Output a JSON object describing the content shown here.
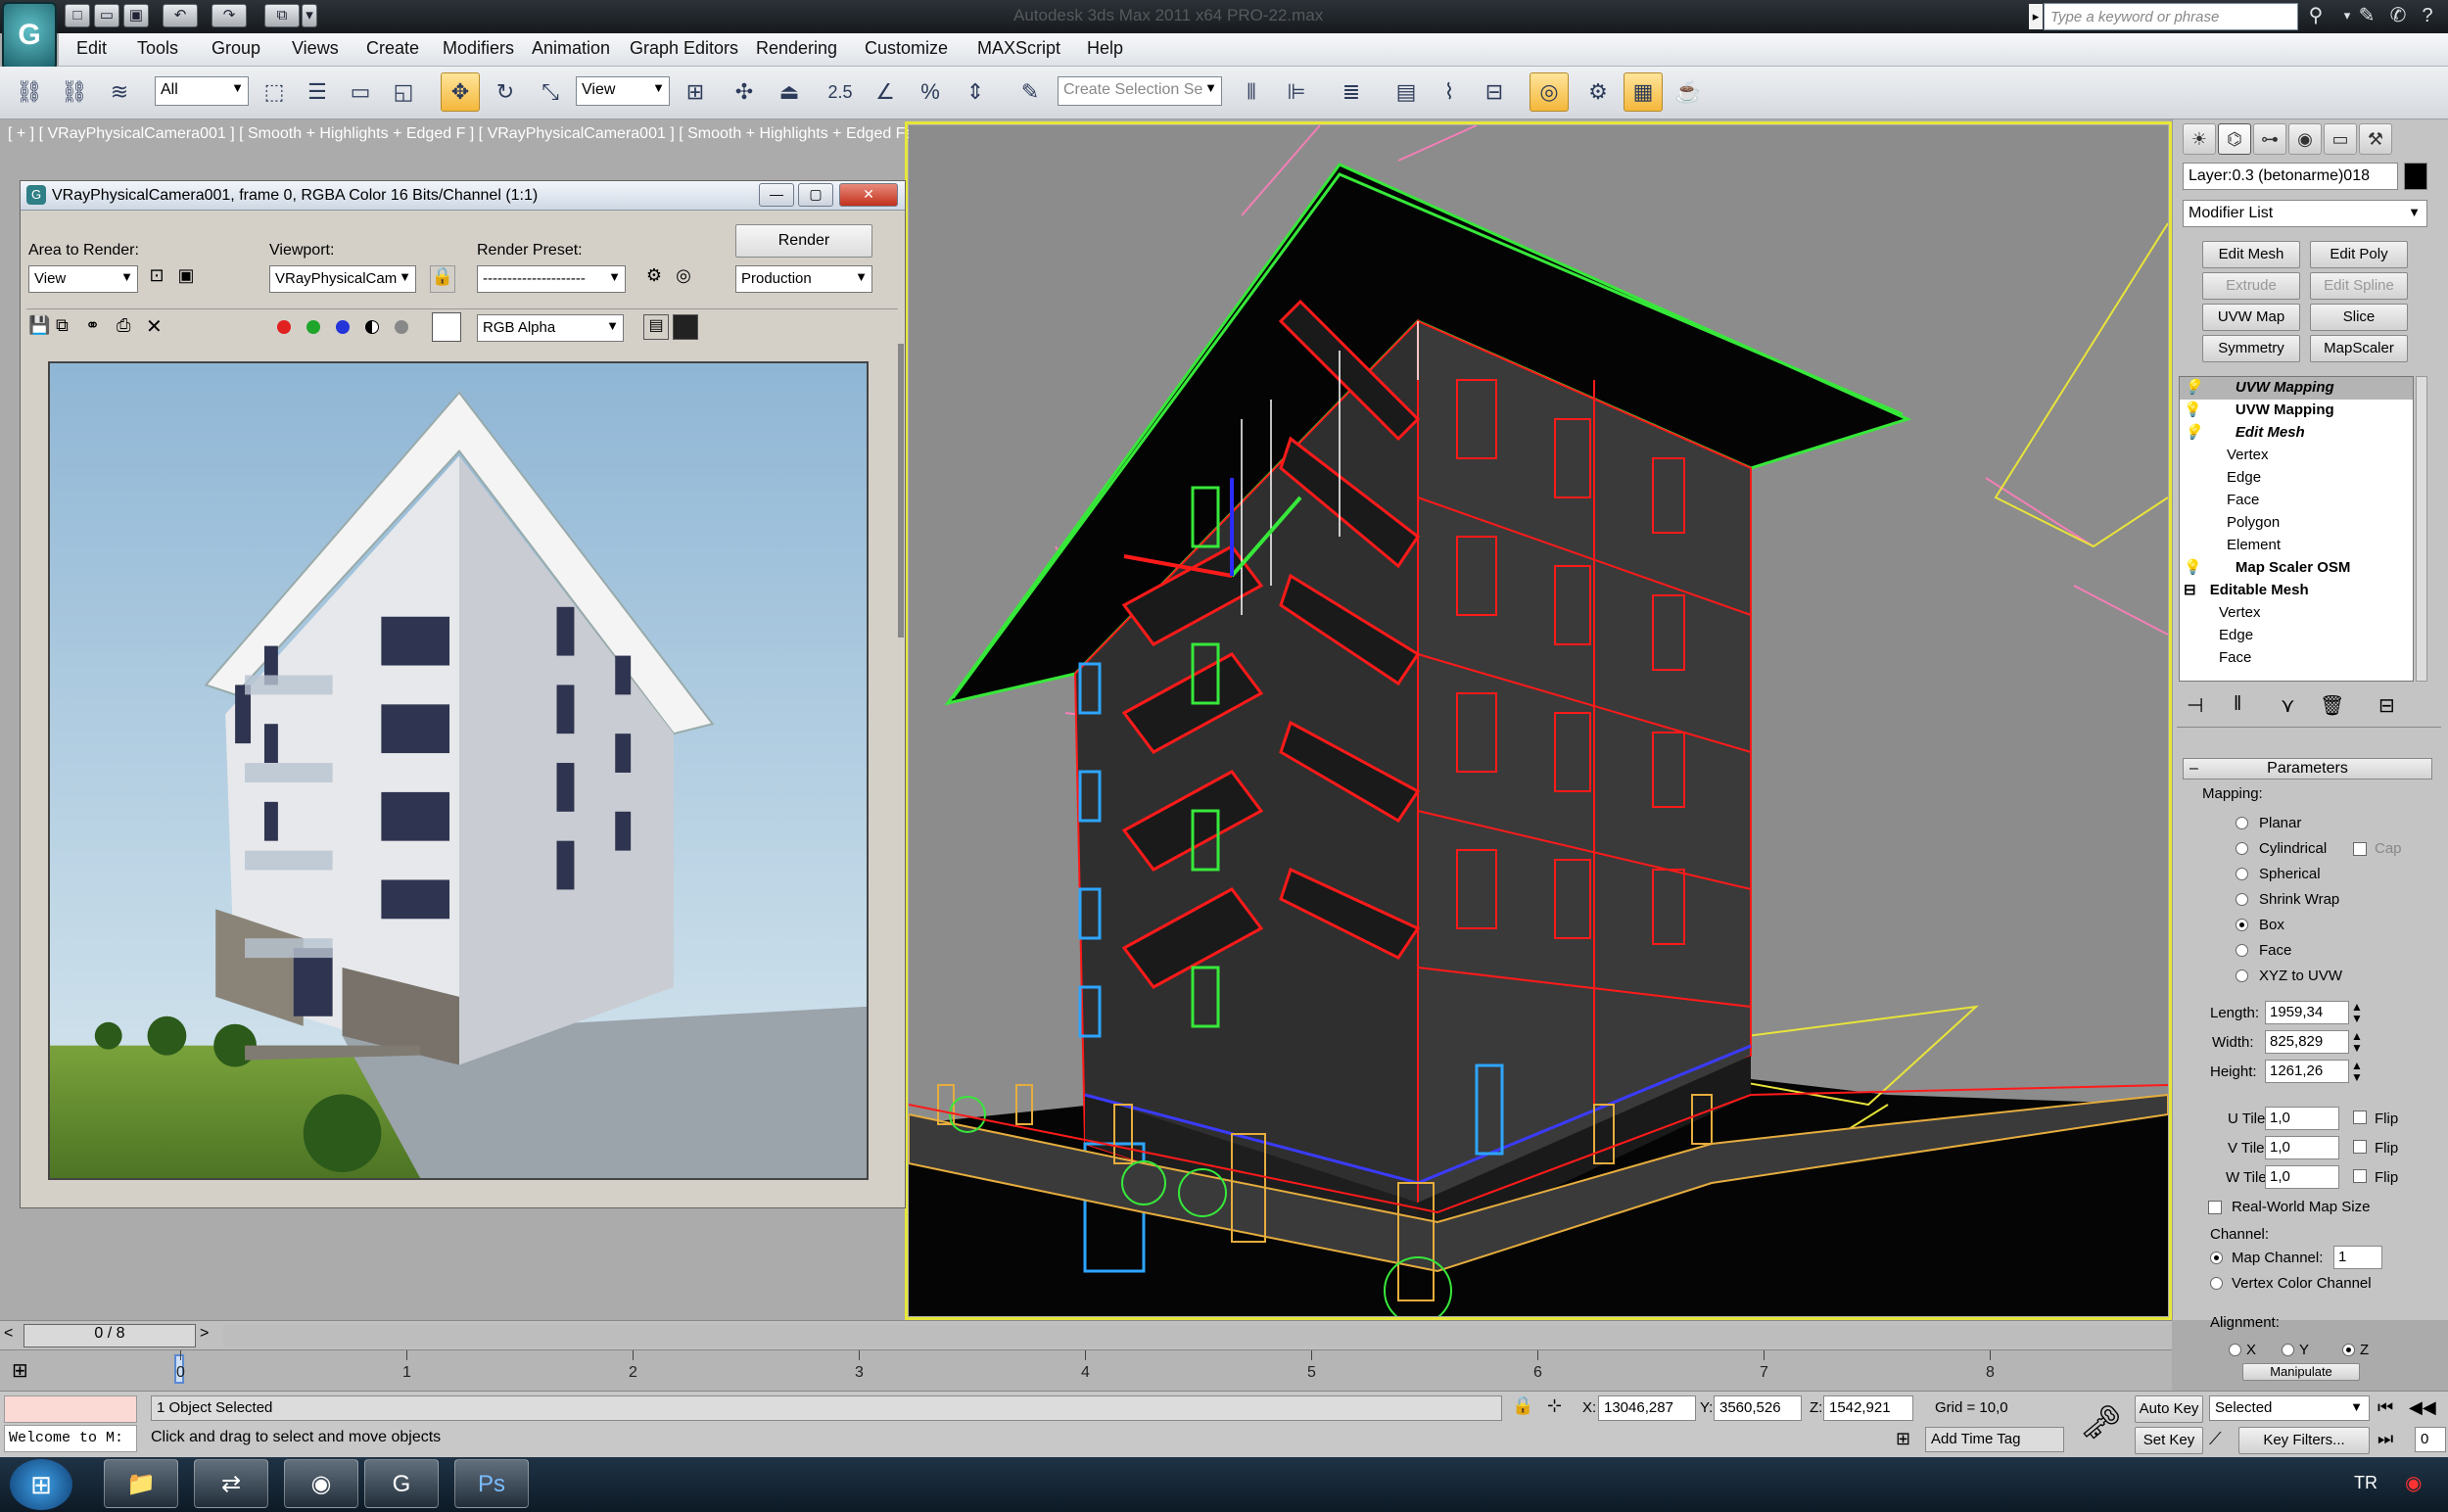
{
  "app": {
    "title": "Autodesk 3ds Max  2011 x64     PRO-22.max",
    "search_placeholder": "Type a keyword or phrase"
  },
  "menu": [
    "Edit",
    "Tools",
    "Group",
    "Views",
    "Create",
    "Modifiers",
    "Animation",
    "Graph Editors",
    "Rendering",
    "Customize",
    "MAXScript",
    "Help"
  ],
  "toolbar": {
    "selection_filter": "All",
    "ref_coord": "View",
    "snap_label": "2.5",
    "named_selection_placeholder": "Create Selection Se"
  },
  "viewport": {
    "label": "[ + ] [ VRayPhysicalCamera001 ] [ Smooth + Highlights + Edged F ] [ VRayPhysicalCamera001 ] [ Smooth + Highlights + Edged Faces ]"
  },
  "frame_buffer": {
    "title": "VRayPhysicalCamera001, frame 0, RGBA Color 16 Bits/Channel (1:1)",
    "area_label": "Area to Render:",
    "area_value": "View",
    "viewport_label": "Viewport:",
    "viewport_value": "VRayPhysicalCam",
    "preset_label": "Render Preset:",
    "preset_value": "---------------------",
    "render_button": "Render",
    "production": "Production",
    "channel": "RGB Alpha"
  },
  "command_panel": {
    "layer_field": "Layer:0.3 (betonarme)018",
    "modifier_list": "Modifier List",
    "buttons": [
      "Edit Mesh",
      "Edit Poly",
      "Extrude",
      "Edit Spline",
      "UVW Map",
      "Slice",
      "Symmetry",
      "MapScaler"
    ],
    "buttons_disabled": [
      false,
      false,
      true,
      true,
      false,
      false,
      false,
      false
    ],
    "stack": [
      {
        "label": "UVW Mapping",
        "kind": "highlight"
      },
      {
        "label": "UVW Mapping",
        "kind": "mod"
      },
      {
        "label": "Edit Mesh",
        "kind": "mod-open"
      },
      {
        "label": "Vertex",
        "kind": "sub"
      },
      {
        "label": "Edge",
        "kind": "sub"
      },
      {
        "label": "Face",
        "kind": "sub"
      },
      {
        "label": "Polygon",
        "kind": "sub"
      },
      {
        "label": "Element",
        "kind": "sub"
      },
      {
        "label": "Map Scaler OSM",
        "kind": "mod"
      },
      {
        "label": "Editable Mesh",
        "kind": "base"
      },
      {
        "label": "Vertex",
        "kind": "sub"
      },
      {
        "label": "Edge",
        "kind": "sub"
      },
      {
        "label": "Face",
        "kind": "sub"
      }
    ],
    "parameters": {
      "rollout": "Parameters",
      "mapping_label": "Mapping:",
      "mapping_options": [
        "Planar",
        "Cylindrical",
        "Spherical",
        "Shrink Wrap",
        "Box",
        "Face",
        "XYZ to UVW"
      ],
      "selected_mapping": "Box",
      "cap": "Cap",
      "length_label": "Length:",
      "length": "1959,34",
      "width_label": "Width:",
      "width": "825,829",
      "height_label": "Height:",
      "height": "1261,26",
      "utile_label": "U Tile:",
      "utile": "1,0",
      "vtile_label": "V Tile:",
      "vtile": "1,0",
      "wtile_label": "W Tile:",
      "wtile": "1,0",
      "flip": "Flip",
      "realworld": "Real-World Map Size",
      "channel_label": "Channel:",
      "map_channel_label": "Map Channel:",
      "map_channel": "1",
      "vertex_color": "Vertex Color Channel",
      "alignment_label": "Alignment:",
      "align_x": "X",
      "align_y": "Y",
      "align_z": "Z",
      "manipulate": "Manipulate"
    }
  },
  "timeline": {
    "frame_counter": "0 / 8",
    "ticks": [
      "0",
      "1",
      "2",
      "3",
      "4",
      "5",
      "6",
      "7",
      "8"
    ]
  },
  "status": {
    "selected": "1 Object Selected",
    "prompt": "Click and drag to select and move objects",
    "welcome": "Welcome to M:",
    "x_label": "X:",
    "x": "13046,287",
    "y_label": "Y:",
    "y": "3560,526",
    "z_label": "Z:",
    "z": "1542,921",
    "grid": "Grid = 10,0",
    "add_time_tag": "Add Time Tag",
    "auto_key": "Auto Key",
    "set_key": "Set Key",
    "selected_dd": "Selected",
    "key_filters": "Key Filters...",
    "frame_field": "0"
  },
  "taskbar": {
    "lang": "TR"
  },
  "colors": {
    "viewport_border": "#e7e73a",
    "wire_red": "#ff1a1a",
    "wire_green": "#37e83a",
    "active_tool": "#f4b73b"
  }
}
